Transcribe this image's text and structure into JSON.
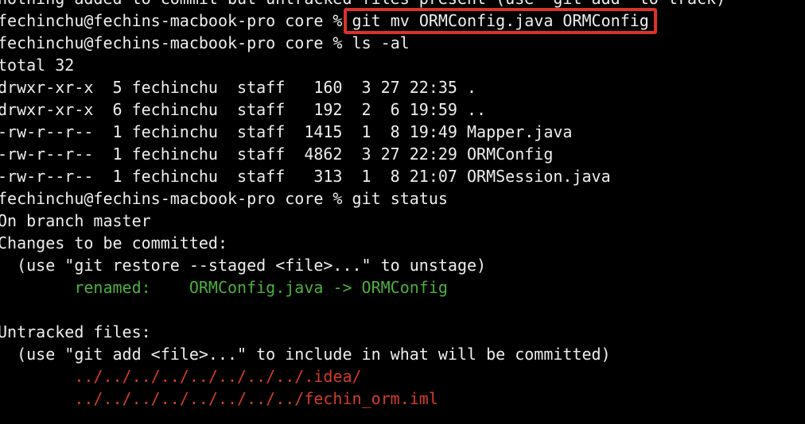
{
  "terminal": {
    "accent_highlight_color": "#d9332b",
    "added_file_color": "#4caf3e",
    "untracked_file_color": "#d23d28",
    "lines": [
      {
        "prompt": "",
        "command": "",
        "text": "nothing added to commit but untracked files present (use \"git add\" to track)"
      },
      {
        "prompt": "fechinchu@fechins-macbook-pro core % ",
        "command": "git mv ORMConfig.java ORMConfig"
      },
      {
        "prompt": "fechinchu@fechins-macbook-pro core % ",
        "command": "ls -al"
      },
      {
        "text": "total 32"
      },
      {
        "text": "drwxr-xr-x  5 fechinchu  staff   160  3 27 22:35 ."
      },
      {
        "text": "drwxr-xr-x  6 fechinchu  staff   192  2  6 19:59 .."
      },
      {
        "text": "-rw-r--r--  1 fechinchu  staff  1415  1  8 19:49 Mapper.java"
      },
      {
        "text": "-rw-r--r--  1 fechinchu  staff  4862  3 27 22:29 ORMConfig"
      },
      {
        "text": "-rw-r--r--  1 fechinchu  staff   313  1  8 21:07 ORMSession.java"
      },
      {
        "prompt": "fechinchu@fechins-macbook-pro core % ",
        "command": "git status"
      },
      {
        "text": "On branch master"
      },
      {
        "text": "Changes to be committed:"
      },
      {
        "text": "  (use \"git restore --staged <file>...\" to unstage)"
      },
      {
        "text": "\trenamed:    ORMConfig.java -> ORMConfig"
      },
      {
        "text": ""
      },
      {
        "text": "Untracked files:"
      },
      {
        "text": "  (use \"git add <file>...\" to include in what will be committed)"
      },
      {
        "text": "\t../../../../../../../../.idea/"
      },
      {
        "text": "\t../../../../../../../../fechin_orm.iml"
      }
    ]
  }
}
